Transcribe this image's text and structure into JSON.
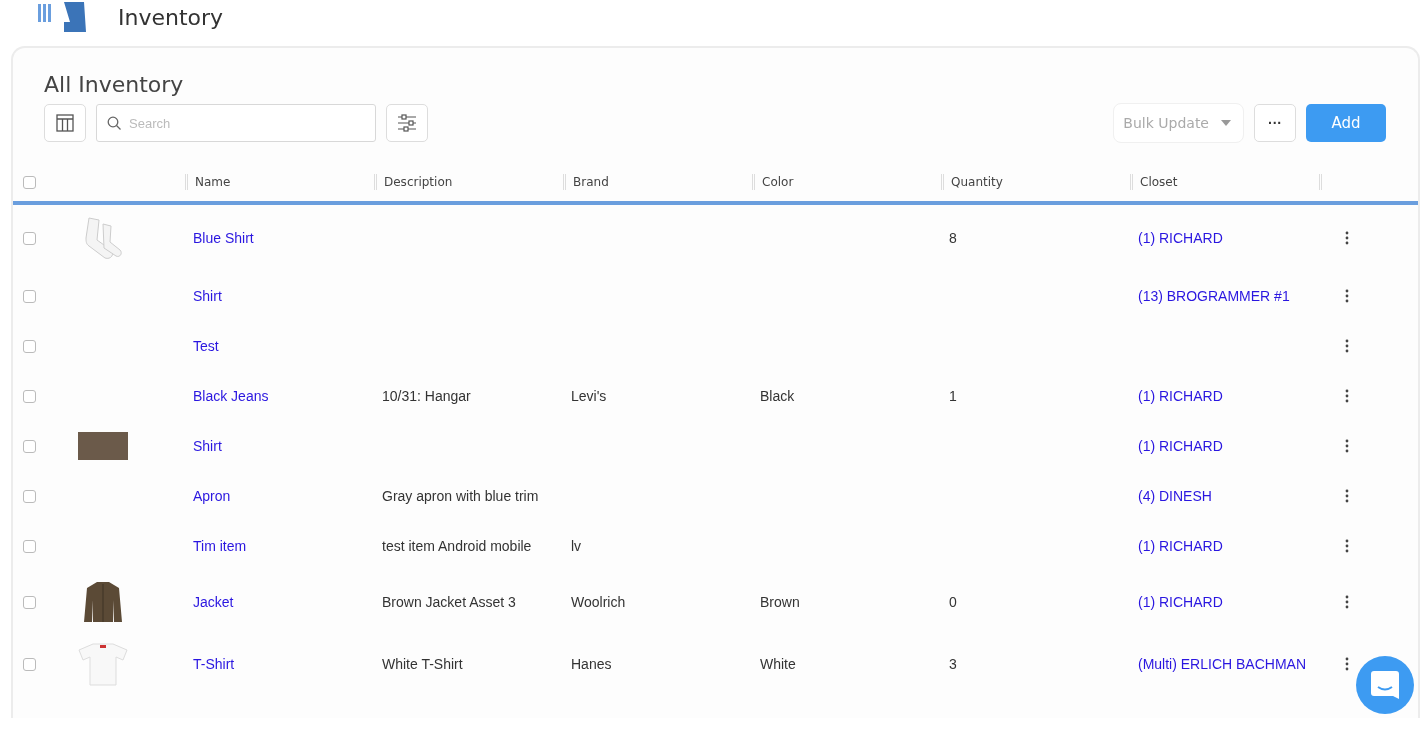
{
  "app": {
    "title": "Inventory"
  },
  "page": {
    "title": "All Inventory"
  },
  "toolbar": {
    "search": {
      "placeholder": "Search"
    },
    "bulk_update": {
      "label": "Bulk Update",
      "disabled": true
    },
    "more": "···",
    "add": "Add"
  },
  "table": {
    "select_all": {
      "checked": false
    },
    "columns": [
      "Name",
      "Description",
      "Brand",
      "Color",
      "Quantity",
      "Closet"
    ],
    "rows": [
      {
        "checked": false,
        "kind": "socks",
        "name": "Blue Shirt",
        "quantity": "8",
        "closet": "(1) RICHARD"
      },
      {
        "checked": false,
        "kind": "plain",
        "name": "Shirt",
        "closet": "(13) BROGRAMMER #1"
      },
      {
        "checked": false,
        "kind": "plain",
        "name": "Test"
      },
      {
        "checked": false,
        "kind": "plain",
        "name": "Black Jeans",
        "description": "10/31: Hangar",
        "brand": "Levi's",
        "color_name": "Black",
        "quantity": "1",
        "closet": "(1) RICHARD"
      },
      {
        "checked": false,
        "kind": "photo",
        "name": "Shirt",
        "closet": "(1) RICHARD"
      },
      {
        "checked": false,
        "kind": "plain",
        "name": "Apron",
        "description": "Gray apron with blue trim",
        "closet": "(4) DINESH"
      },
      {
        "checked": false,
        "kind": "plain",
        "name": "Tim item",
        "description": "test item Android mobile",
        "brand": "lv",
        "closet": "(1) RICHARD"
      },
      {
        "checked": false,
        "kind": "jacket",
        "name": "Jacket",
        "description": "Brown Jacket Asset 3",
        "brand": "Woolrich",
        "color_name": "Brown",
        "quantity": "0",
        "closet": "(1) RICHARD"
      },
      {
        "checked": false,
        "kind": "tshirt",
        "name": "T-Shirt",
        "description": "White T-Shirt",
        "brand": "Hanes",
        "color_name": "White",
        "quantity": "3",
        "closet": "(Multi) ERLICH BACHMAN"
      }
    ]
  }
}
